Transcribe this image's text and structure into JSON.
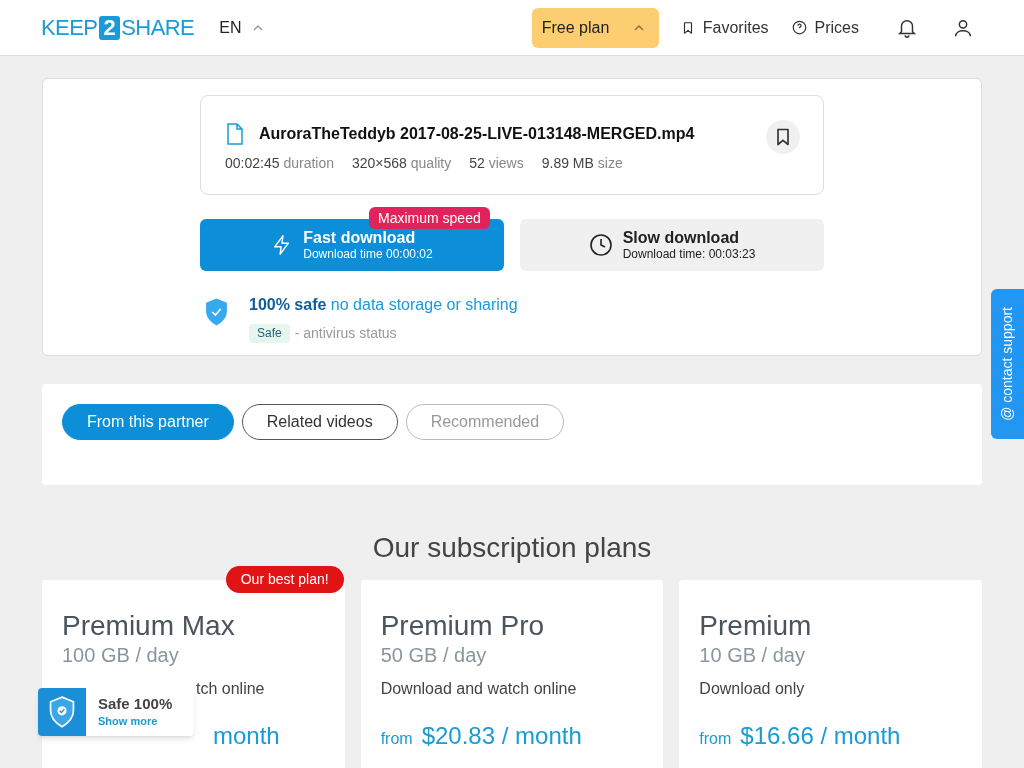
{
  "header": {
    "logo": {
      "left": "KEEP",
      "middle": "2",
      "right": "SHARE"
    },
    "language": "EN",
    "plan_button": "Free plan",
    "nav": [
      {
        "kind": "favorites",
        "label": "Favorites"
      },
      {
        "kind": "prices",
        "label": "Prices"
      }
    ]
  },
  "file": {
    "name": "AuroraTheTeddyb 2017-08-25-LIVE-013148-MERGED.mp4",
    "meta": [
      {
        "amount": "00:02:45",
        "unit": "duration"
      },
      {
        "amount": "320×568",
        "unit": "quality"
      },
      {
        "amount": "52",
        "unit": "views"
      },
      {
        "amount": "9.89 MB",
        "unit": "size"
      }
    ]
  },
  "downloads": [
    {
      "kind": "fast",
      "title": "Fast download",
      "subtitle": "Download time 00:00:02",
      "badge": "Maximum speed"
    },
    {
      "kind": "slow",
      "title": "Slow download",
      "subtitle": "Download time: 00:03:23"
    }
  ],
  "safety": {
    "headline": "**100% safe** no data storage or sharing",
    "tag": "Safe",
    "status": "- antivirus status"
  },
  "tabs": [
    {
      "label": "From this partner",
      "selected": true,
      "disabled": false
    },
    {
      "label": "Related videos",
      "selected": false,
      "disabled": false
    },
    {
      "label": "Recommended",
      "selected": false,
      "disabled": true
    }
  ],
  "plans_title": "Our subscription plans",
  "plans": [
    {
      "name": "Premium Max",
      "quota": "100 GB / day",
      "description": "tch online",
      "price": "month",
      "badge": "Our best plan!",
      "kind": "partly_covered"
    },
    {
      "name": "Premium Pro",
      "quota": "50 GB / day",
      "description": "Download and watch online",
      "from": "from",
      "price": "$20.83 / month"
    },
    {
      "name": "Premium",
      "quota": "10 GB / day",
      "description": "Download only",
      "from": "from",
      "price": "$16.66 / month"
    }
  ],
  "safe_widget": {
    "title": "Safe 100%",
    "link": "Show more"
  },
  "contact_support": "@ contact support"
}
